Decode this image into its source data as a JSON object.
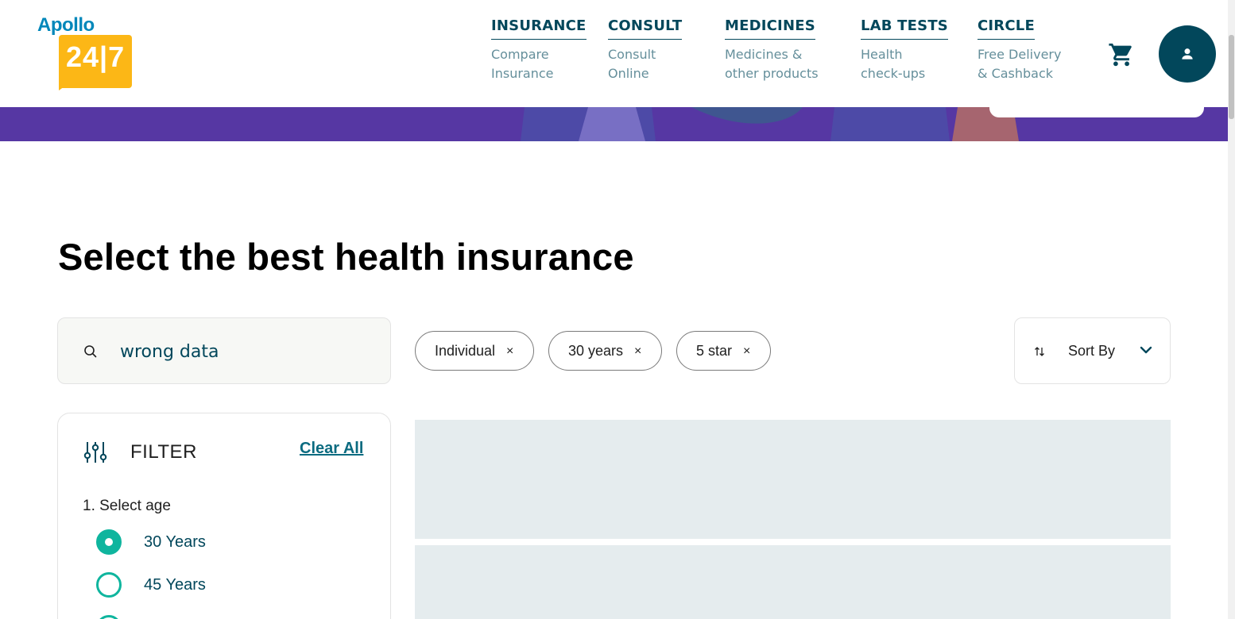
{
  "header": {
    "logo": {
      "brand": "Apollo",
      "number": "24|7"
    },
    "nav": [
      {
        "title": "INSURANCE",
        "subtitle": "Compare\nInsurance"
      },
      {
        "title": "CONSULT",
        "subtitle": "Consult\nOnline"
      },
      {
        "title": "MEDICINES",
        "subtitle": "Medicines &\nother products"
      },
      {
        "title": "LAB TESTS",
        "subtitle": "Health\ncheck-ups"
      },
      {
        "title": "CIRCLE",
        "subtitle": "Free Delivery\n& Cashback"
      }
    ],
    "cart_icon": "shopping-cart-icon",
    "profile_icon": "user-icon"
  },
  "banner": {
    "color": "#5637a3"
  },
  "page": {
    "title": "Select the best health insurance"
  },
  "search": {
    "value": "wrong data",
    "icon": "search-icon"
  },
  "chips": [
    {
      "label": "Individual",
      "close": "×"
    },
    {
      "label": "30 years",
      "close": "×"
    },
    {
      "label": "5 star",
      "close": "×"
    }
  ],
  "sort": {
    "label": "Sort By",
    "icon": "sort-arrows-icon",
    "chevron": "chevron-down-icon"
  },
  "filter": {
    "title": "FILTER",
    "icon": "sliders-icon",
    "clear_all": "Clear All",
    "age_heading": "1. Select age",
    "age_options": [
      {
        "label": "30 Years",
        "checked": true
      },
      {
        "label": "45 Years",
        "checked": false
      },
      {
        "label": "",
        "checked": false
      }
    ]
  },
  "colors": {
    "primary": "#02475b",
    "accent": "#0fb59e",
    "logo_yellow": "#fcb716",
    "logo_blue": "#0087ba",
    "skeleton": "#e5ecee"
  }
}
